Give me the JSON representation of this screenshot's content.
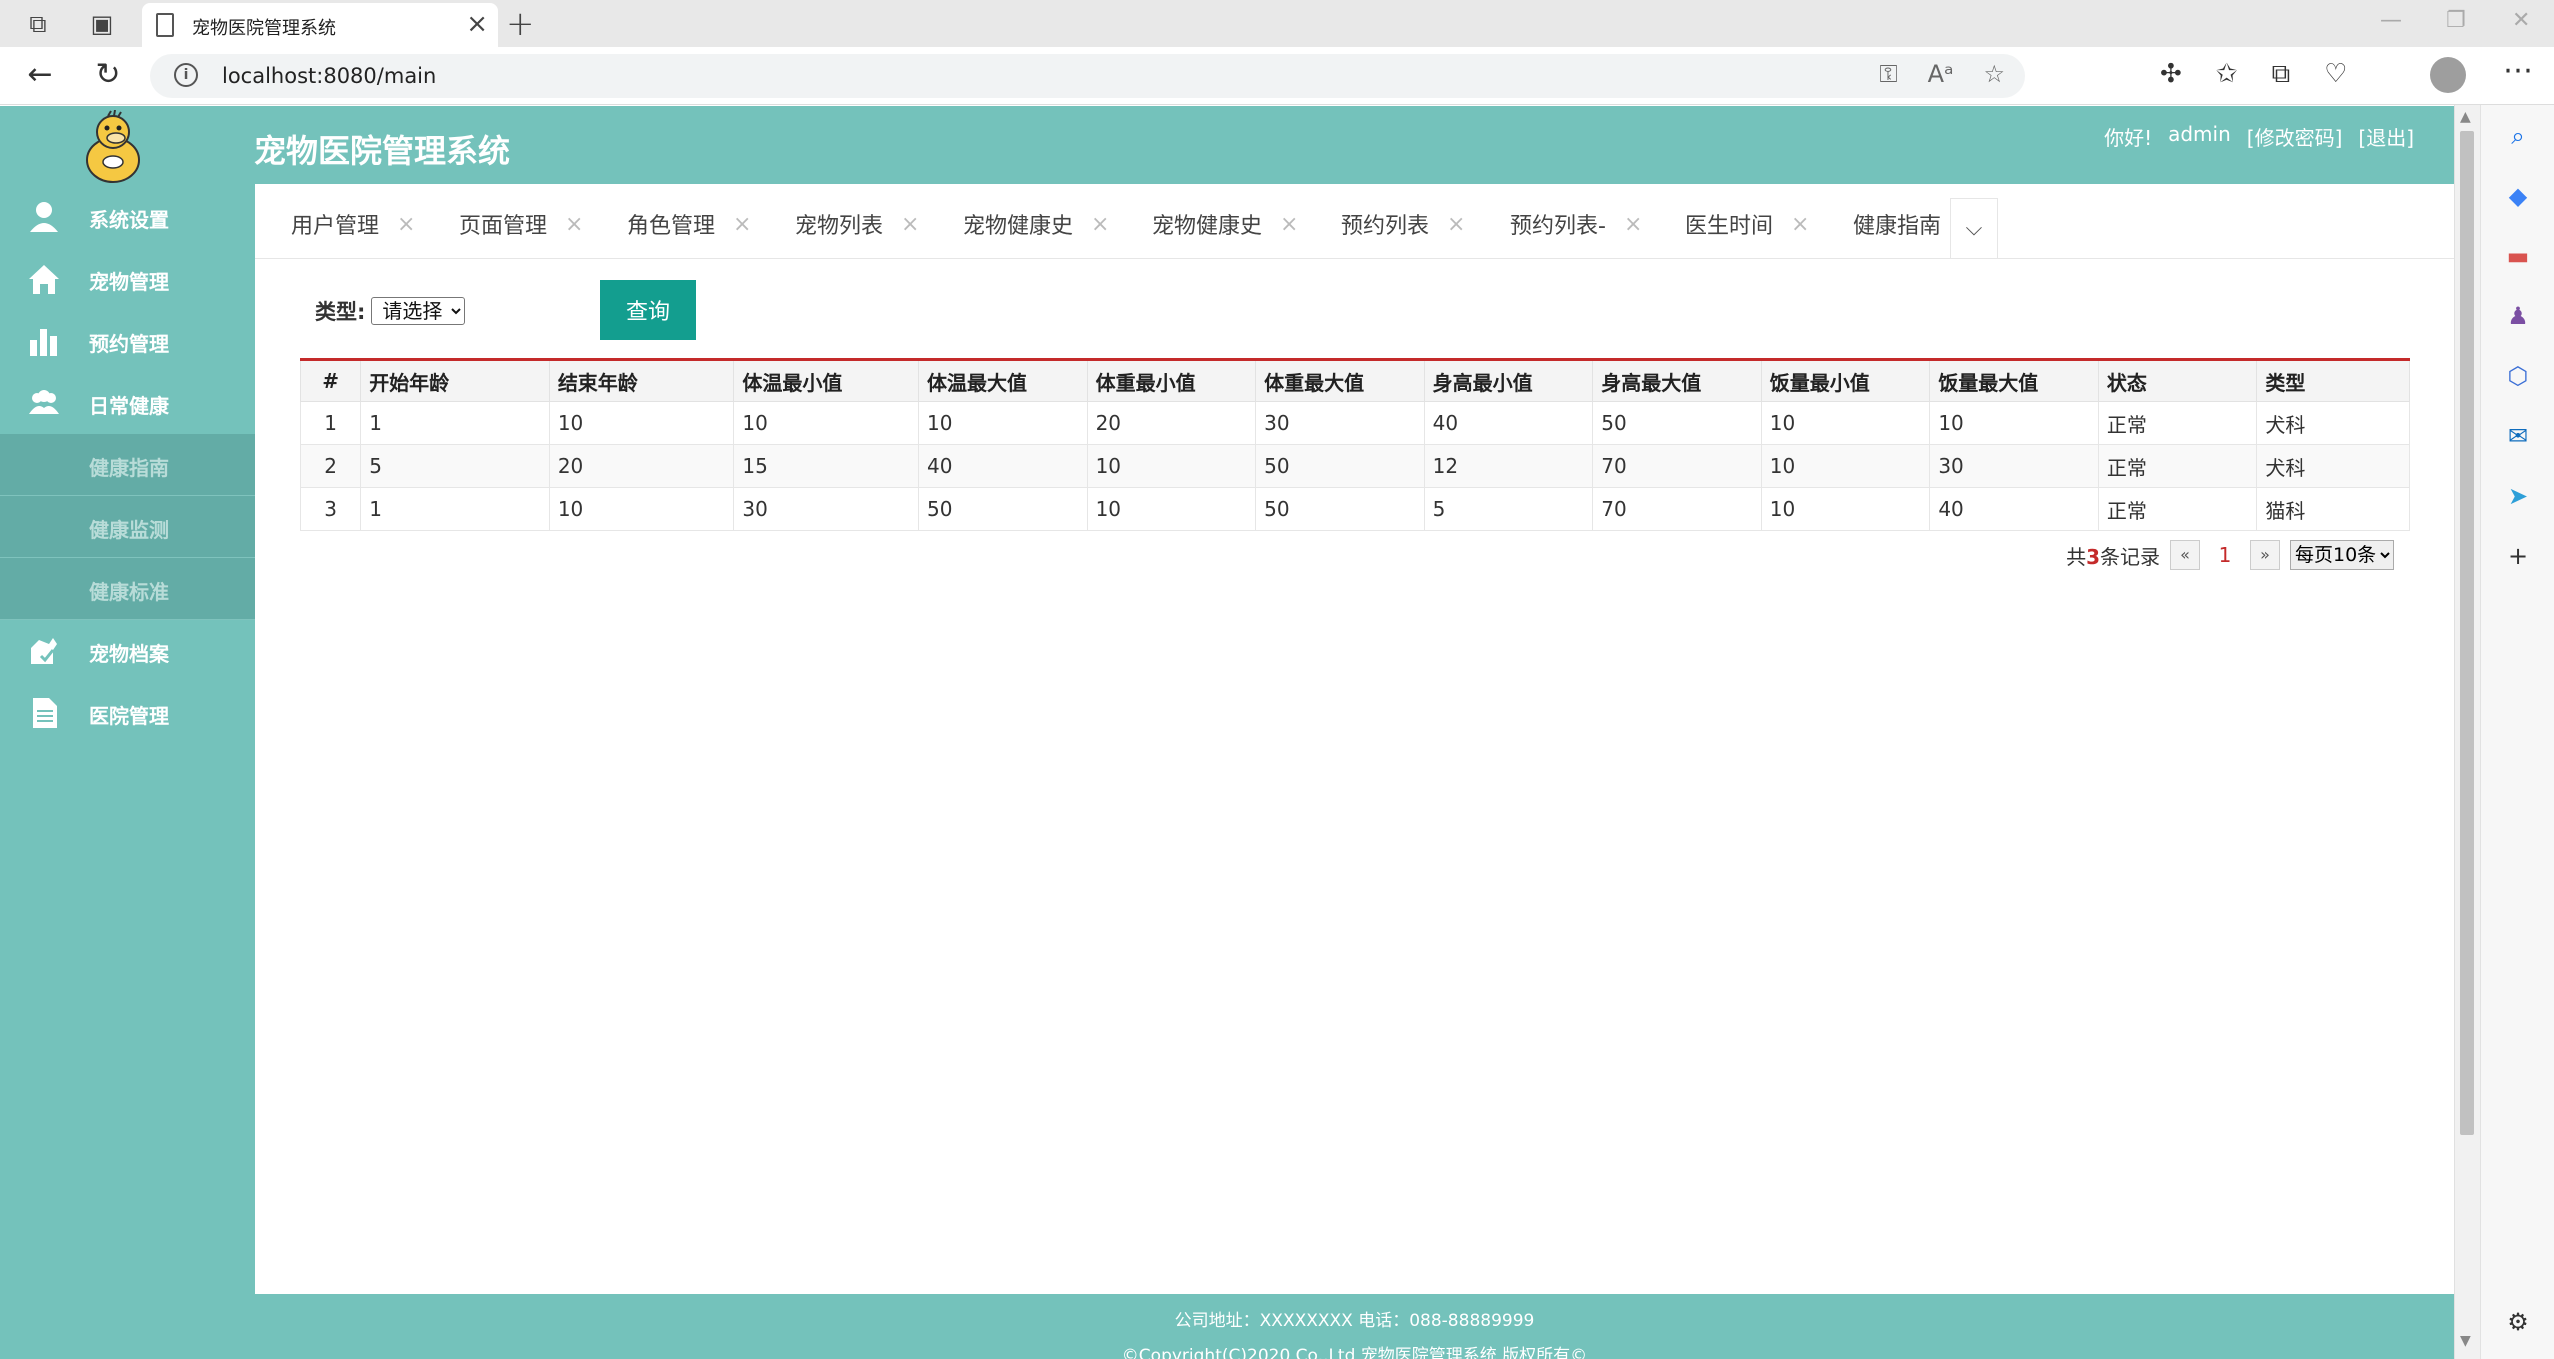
{
  "browser": {
    "tab_title": "宠物医院管理系统",
    "url": "localhost:8080/main"
  },
  "header": {
    "title": "宠物医院管理系统",
    "greeting": "你好!",
    "username": "admin",
    "change_password": "[修改密码]",
    "logout": "[退出]"
  },
  "sidebar": {
    "items": [
      {
        "label": "系统设置",
        "icon": "user-icon"
      },
      {
        "label": "宠物管理",
        "icon": "home-icon"
      },
      {
        "label": "预约管理",
        "icon": "bar-chart-icon"
      },
      {
        "label": "日常健康",
        "icon": "group-icon"
      }
    ],
    "sub_items": [
      {
        "label": "健康指南"
      },
      {
        "label": "健康监测"
      },
      {
        "label": "健康标准"
      }
    ],
    "items_after": [
      {
        "label": "宠物档案",
        "icon": "pet-record-icon"
      },
      {
        "label": "医院管理",
        "icon": "document-icon"
      }
    ]
  },
  "tabs": [
    "用户管理",
    "页面管理",
    "角色管理",
    "宠物列表",
    "宠物健康史",
    "宠物健康史",
    "预约列表",
    "预约列表-",
    "医生时间",
    "健康指南"
  ],
  "filter": {
    "label": "类型:",
    "select_value": "请选择",
    "query_button": "查询"
  },
  "table": {
    "columns": [
      "#",
      "开始年龄",
      "结束年龄",
      "体温最小值",
      "体温最大值",
      "体重最小值",
      "体重最大值",
      "身高最小值",
      "身高最大值",
      "饭量最小值",
      "饭量最大值",
      "状态",
      "类型"
    ],
    "rows": [
      [
        "1",
        "1",
        "10",
        "10",
        "10",
        "20",
        "30",
        "40",
        "50",
        "10",
        "10",
        "正常",
        "犬科"
      ],
      [
        "2",
        "5",
        "20",
        "15",
        "40",
        "10",
        "50",
        "12",
        "70",
        "10",
        "30",
        "正常",
        "犬科"
      ],
      [
        "3",
        "1",
        "10",
        "30",
        "50",
        "10",
        "50",
        "5",
        "70",
        "10",
        "40",
        "正常",
        "猫科"
      ]
    ]
  },
  "pager": {
    "total_prefix": "共",
    "total_count": "3",
    "total_suffix": "条记录",
    "prev": "«",
    "current": "1",
    "next": "»",
    "page_size": "每页10条"
  },
  "footer": {
    "line1": "公司地址：XXXXXXXX 电话：088-88889999",
    "line2": "©Copyright(C)2020 Co.,Ltd 宠物医院管理系统 版权所有©"
  },
  "colors": {
    "theme": "#74c2bb",
    "sub_menu": "#63aca6",
    "query_button": "#139e8f",
    "table_accent": "#c42a2a"
  }
}
